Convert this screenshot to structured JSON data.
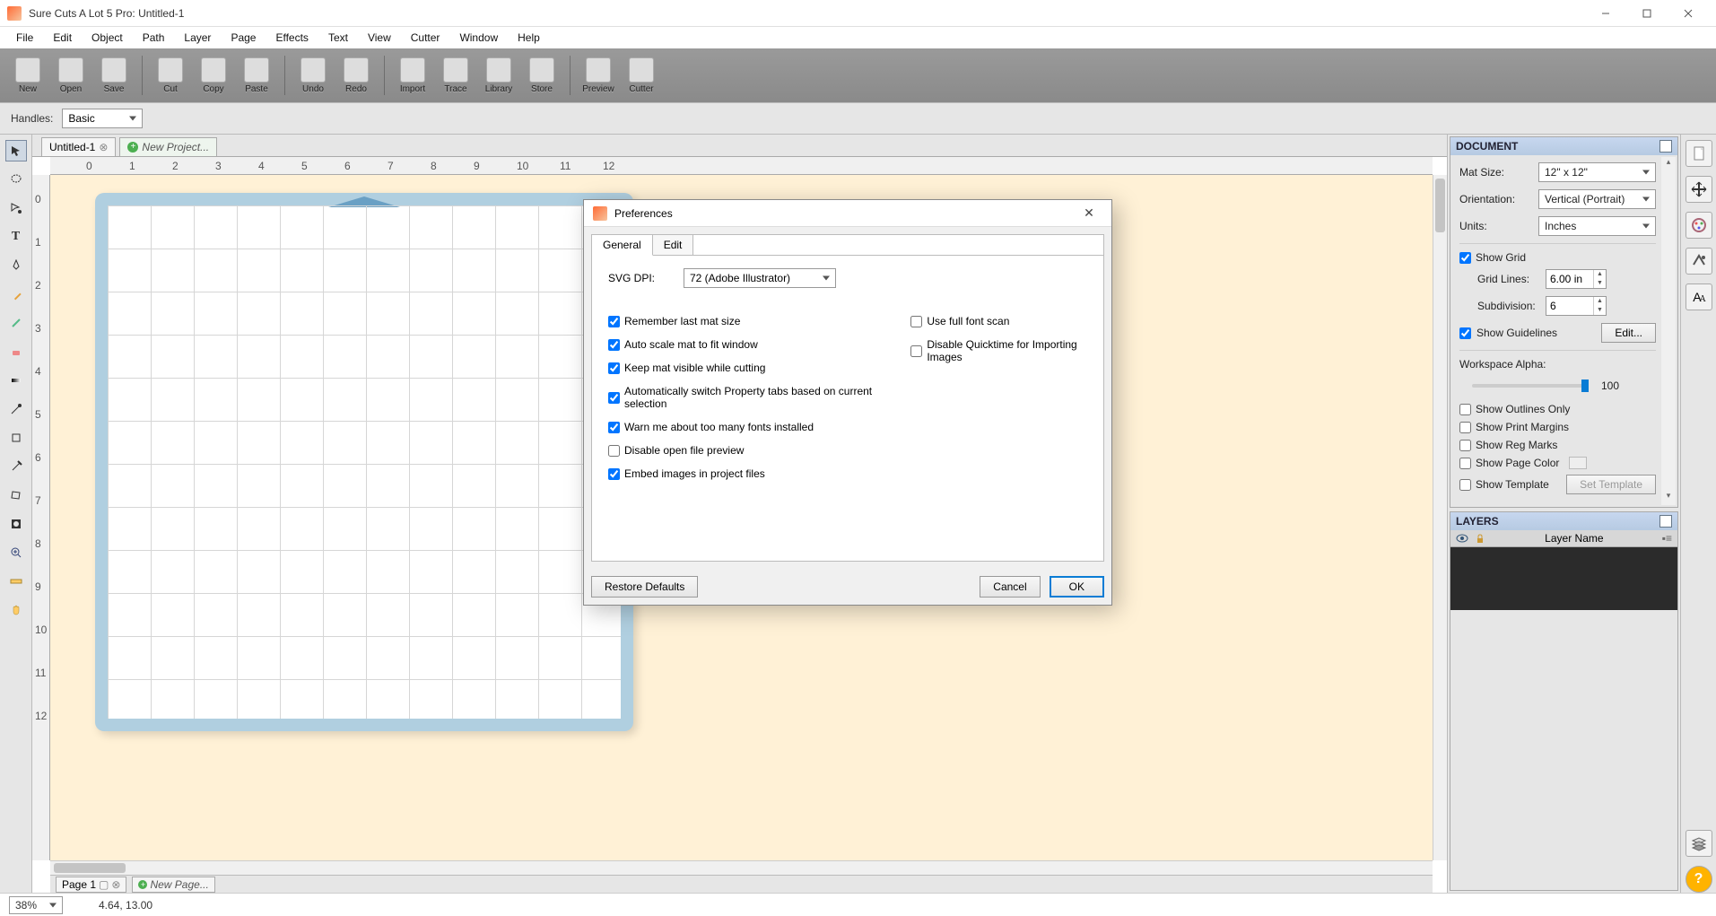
{
  "app": {
    "title": "Sure Cuts A Lot 5 Pro: Untitled-1"
  },
  "menu": [
    "File",
    "Edit",
    "Object",
    "Path",
    "Layer",
    "Page",
    "Effects",
    "Text",
    "View",
    "Cutter",
    "Window",
    "Help"
  ],
  "toolbar": [
    {
      "name": "new",
      "label": "New"
    },
    {
      "name": "open",
      "label": "Open"
    },
    {
      "name": "save",
      "label": "Save"
    },
    {
      "sep": true
    },
    {
      "name": "cut",
      "label": "Cut"
    },
    {
      "name": "copy",
      "label": "Copy"
    },
    {
      "name": "paste",
      "label": "Paste"
    },
    {
      "sep": true
    },
    {
      "name": "undo",
      "label": "Undo"
    },
    {
      "name": "redo",
      "label": "Redo"
    },
    {
      "sep": true
    },
    {
      "name": "import",
      "label": "Import"
    },
    {
      "name": "trace",
      "label": "Trace"
    },
    {
      "name": "library",
      "label": "Library"
    },
    {
      "name": "store",
      "label": "Store"
    },
    {
      "sep": true
    },
    {
      "name": "preview",
      "label": "Preview"
    },
    {
      "name": "cutter",
      "label": "Cutter"
    }
  ],
  "handles": {
    "label": "Handles:",
    "value": "Basic"
  },
  "docTabs": {
    "current": "Untitled-1",
    "new": "New Project..."
  },
  "pageTabs": {
    "current": "Page 1",
    "new": "New Page..."
  },
  "status": {
    "zoom": "38%",
    "coords": "4.64, 13.00"
  },
  "docPanel": {
    "title": "DOCUMENT",
    "matSizeLabel": "Mat Size:",
    "matSize": "12\" x 12\"",
    "orientationLabel": "Orientation:",
    "orientation": "Vertical (Portrait)",
    "unitsLabel": "Units:",
    "units": "Inches",
    "showGrid": "Show Grid",
    "gridLinesLabel": "Grid Lines:",
    "gridLines": "6.00 in",
    "subdivisionLabel": "Subdivision:",
    "subdivision": "6",
    "showGuidelines": "Show Guidelines",
    "editBtn": "Edit...",
    "workspaceAlphaLabel": "Workspace Alpha:",
    "workspaceAlpha": "100",
    "showOutlines": "Show Outlines Only",
    "showPrintMargins": "Show Print Margins",
    "showRegMarks": "Show Reg Marks",
    "showPageColor": "Show Page Color",
    "showTemplate": "Show Template",
    "setTemplate": "Set Template"
  },
  "layersPanel": {
    "title": "LAYERS",
    "header": "Layer Name"
  },
  "dialog": {
    "title": "Preferences",
    "tabs": [
      "General",
      "Edit"
    ],
    "svgDpiLabel": "SVG DPI:",
    "svgDpi": "72 (Adobe Illustrator)",
    "col1": [
      {
        "checked": true,
        "label": "Remember last mat size"
      },
      {
        "checked": true,
        "label": "Auto scale mat to fit window"
      },
      {
        "checked": true,
        "label": "Keep mat visible while cutting"
      },
      {
        "checked": true,
        "label": "Automatically switch Property tabs based on current selection"
      },
      {
        "checked": true,
        "label": "Warn me about too many fonts installed"
      },
      {
        "checked": false,
        "label": "Disable open file preview"
      },
      {
        "checked": true,
        "label": "Embed images in project files"
      }
    ],
    "col2": [
      {
        "checked": false,
        "label": "Use full font scan"
      },
      {
        "checked": false,
        "label": "Disable Quicktime for Importing Images"
      }
    ],
    "restore": "Restore Defaults",
    "cancel": "Cancel",
    "ok": "OK"
  },
  "ruler_h": [
    0,
    1,
    2,
    3,
    4,
    5,
    6,
    7,
    8,
    9,
    10,
    11,
    12
  ],
  "ruler_v": [
    0,
    1,
    2,
    3,
    4,
    5,
    6,
    7,
    8,
    9,
    10,
    11,
    12
  ]
}
